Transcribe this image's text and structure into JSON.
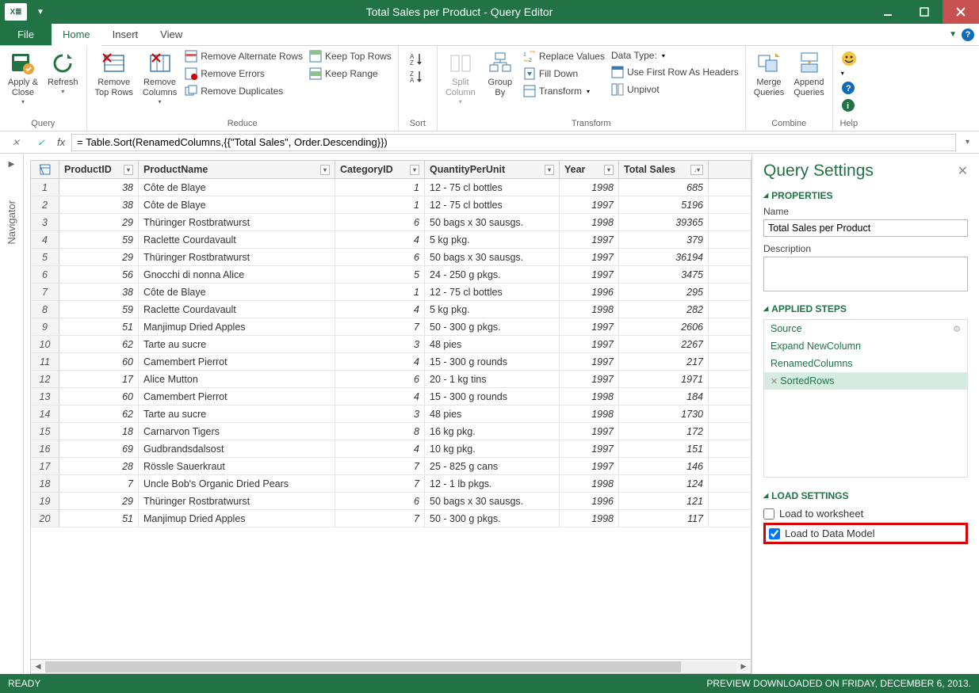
{
  "window": {
    "title": "Total Sales per Product - Query Editor"
  },
  "tabs": {
    "file": "File",
    "home": "Home",
    "insert": "Insert",
    "view": "View"
  },
  "ribbon": {
    "query": {
      "label": "Query",
      "apply_close": "Apply &\nClose",
      "refresh": "Refresh"
    },
    "reduce": {
      "label": "Reduce",
      "remove_top_rows": "Remove\nTop Rows",
      "remove_columns": "Remove\nColumns",
      "remove_alt": "Remove Alternate Rows",
      "remove_err": "Remove Errors",
      "remove_dup": "Remove Duplicates",
      "keep_top": "Keep Top Rows",
      "keep_range": "Keep Range"
    },
    "sort": {
      "label": "Sort"
    },
    "transform": {
      "label": "Transform",
      "split_col": "Split\nColumn",
      "group_by": "Group\nBy",
      "replace": "Replace Values",
      "fill_down": "Fill Down",
      "transform": "Transform",
      "data_type": "Data Type:",
      "first_row": "Use First Row As Headers",
      "unpivot": "Unpivot"
    },
    "combine": {
      "label": "Combine",
      "merge": "Merge\nQueries",
      "append": "Append\nQueries"
    },
    "help": {
      "label": "Help"
    }
  },
  "formula": "= Table.Sort(RenamedColumns,{{\"Total Sales\", Order.Descending}})",
  "navigator": "Navigator",
  "columns": {
    "product_id": "ProductID",
    "product_name": "ProductName",
    "category_id": "CategoryID",
    "qpu": "QuantityPerUnit",
    "year": "Year",
    "total": "Total Sales"
  },
  "rows": [
    {
      "n": 1,
      "pid": 38,
      "name": "Côte de Blaye",
      "cat": 1,
      "qpu": "12 - 75 cl bottles",
      "year": 1998,
      "total": "685"
    },
    {
      "n": 2,
      "pid": 38,
      "name": "Côte de Blaye",
      "cat": 1,
      "qpu": "12 - 75 cl bottles",
      "year": 1997,
      "total": "5196"
    },
    {
      "n": 3,
      "pid": 29,
      "name": "Thüringer Rostbratwurst",
      "cat": 6,
      "qpu": "50 bags x 30 sausgs.",
      "year": 1998,
      "total": "39365"
    },
    {
      "n": 4,
      "pid": 59,
      "name": "Raclette Courdavault",
      "cat": 4,
      "qpu": "5 kg pkg.",
      "year": 1997,
      "total": "379"
    },
    {
      "n": 5,
      "pid": 29,
      "name": "Thüringer Rostbratwurst",
      "cat": 6,
      "qpu": "50 bags x 30 sausgs.",
      "year": 1997,
      "total": "36194"
    },
    {
      "n": 6,
      "pid": 56,
      "name": "Gnocchi di nonna Alice",
      "cat": 5,
      "qpu": "24 - 250 g pkgs.",
      "year": 1997,
      "total": "3475"
    },
    {
      "n": 7,
      "pid": 38,
      "name": "Côte de Blaye",
      "cat": 1,
      "qpu": "12 - 75 cl bottles",
      "year": 1996,
      "total": "295"
    },
    {
      "n": 8,
      "pid": 59,
      "name": "Raclette Courdavault",
      "cat": 4,
      "qpu": "5 kg pkg.",
      "year": 1998,
      "total": "282"
    },
    {
      "n": 9,
      "pid": 51,
      "name": "Manjimup Dried Apples",
      "cat": 7,
      "qpu": "50 - 300 g pkgs.",
      "year": 1997,
      "total": "2606"
    },
    {
      "n": 10,
      "pid": 62,
      "name": "Tarte au sucre",
      "cat": 3,
      "qpu": "48 pies",
      "year": 1997,
      "total": "2267"
    },
    {
      "n": 11,
      "pid": 60,
      "name": "Camembert Pierrot",
      "cat": 4,
      "qpu": "15 - 300 g rounds",
      "year": 1997,
      "total": "217"
    },
    {
      "n": 12,
      "pid": 17,
      "name": "Alice Mutton",
      "cat": 6,
      "qpu": "20 - 1 kg tins",
      "year": 1997,
      "total": "1971"
    },
    {
      "n": 13,
      "pid": 60,
      "name": "Camembert Pierrot",
      "cat": 4,
      "qpu": "15 - 300 g rounds",
      "year": 1998,
      "total": "184"
    },
    {
      "n": 14,
      "pid": 62,
      "name": "Tarte au sucre",
      "cat": 3,
      "qpu": "48 pies",
      "year": 1998,
      "total": "1730"
    },
    {
      "n": 15,
      "pid": 18,
      "name": "Carnarvon Tigers",
      "cat": 8,
      "qpu": "16 kg pkg.",
      "year": 1997,
      "total": "172"
    },
    {
      "n": 16,
      "pid": 69,
      "name": "Gudbrandsdalsost",
      "cat": 4,
      "qpu": "10 kg pkg.",
      "year": 1997,
      "total": "151"
    },
    {
      "n": 17,
      "pid": 28,
      "name": "Rössle Sauerkraut",
      "cat": 7,
      "qpu": "25 - 825 g cans",
      "year": 1997,
      "total": "146"
    },
    {
      "n": 18,
      "pid": 7,
      "name": "Uncle Bob's Organic Dried Pears",
      "cat": 7,
      "qpu": "12 - 1 lb pkgs.",
      "year": 1998,
      "total": "124"
    },
    {
      "n": 19,
      "pid": 29,
      "name": "Thüringer Rostbratwurst",
      "cat": 6,
      "qpu": "50 bags x 30 sausgs.",
      "year": 1996,
      "total": "121"
    },
    {
      "n": 20,
      "pid": 51,
      "name": "Manjimup Dried Apples",
      "cat": 7,
      "qpu": "50 - 300 g pkgs.",
      "year": 1998,
      "total": "117"
    }
  ],
  "settings": {
    "title": "Query Settings",
    "props": "PROPERTIES",
    "name_lbl": "Name",
    "name_val": "Total Sales per Product",
    "desc_lbl": "Description",
    "steps": "APPLIED STEPS",
    "step_list": [
      "Source",
      "Expand NewColumn",
      "RenamedColumns",
      "SortedRows"
    ],
    "load": "LOAD SETTINGS",
    "load_ws": "Load to worksheet",
    "load_dm": "Load to Data Model"
  },
  "status": {
    "ready": "READY",
    "preview": "PREVIEW DOWNLOADED ON FRIDAY, DECEMBER 6, 2013."
  }
}
